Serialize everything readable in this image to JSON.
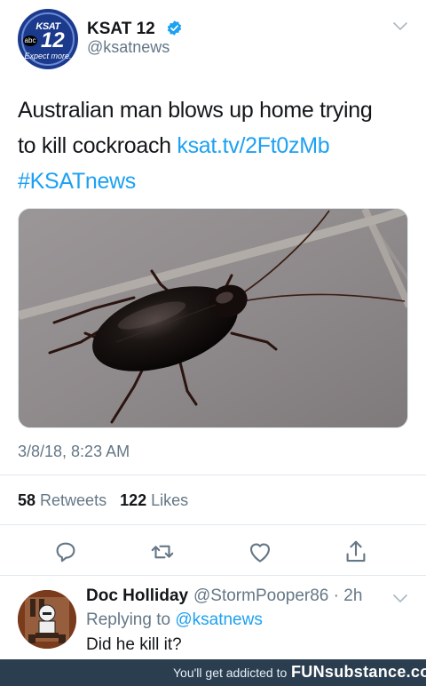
{
  "tweet": {
    "author": {
      "name": "KSAT 12",
      "handle": "@ksatnews",
      "avatar_logo_text": "KSAT",
      "avatar_logo_number": "12",
      "avatar_network": "abc",
      "avatar_tagline": "Expect more."
    },
    "text_line1": "Australian man blows up home trying",
    "text_line2_prefix": "to kill cockroach ",
    "link": "ksat.tv/2Ft0zMb",
    "hashtag": "#KSATnews",
    "timestamp": "3/8/18, 8:23 AM",
    "stats": {
      "retweets_count": "58",
      "retweets_label": " Retweets",
      "likes_count": "122",
      "likes_label": " Likes"
    }
  },
  "reply": {
    "name": "Doc Holliday",
    "handle": "@StormPooper86 · 2h",
    "replying_prefix": "Replying to ",
    "replying_to": "@ksatnews",
    "text": "Did he kill it?"
  },
  "footer": {
    "slogan": "You'll get addicted to",
    "brand": "FUNsubstance.com"
  },
  "colors": {
    "accent": "#1da1f2",
    "secondary_text": "#657786",
    "footer_bg": "#2b3e50"
  }
}
